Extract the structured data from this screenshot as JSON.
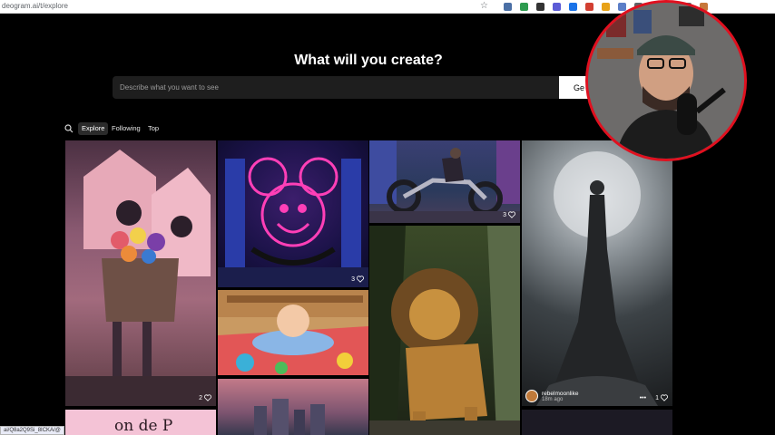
{
  "browser": {
    "url": "deogram.ai/t/explore",
    "status_url": "ai/Q8a2Q9Si_8ICKA/@",
    "extension_icons": [
      "#4a6fa5",
      "#2d9b4f",
      "#333333",
      "#5b5bd6",
      "#1a73e8",
      "#d23f31",
      "#e8a217",
      "#5b7ec7",
      "#5f6368",
      "#333333",
      "#5f6368",
      "#5f6368",
      "#c7773a"
    ]
  },
  "heading": "What will you create?",
  "prompt": {
    "placeholder": "Describe what you want to see",
    "generate_label": "Ge"
  },
  "tabs": [
    {
      "label": "Explore",
      "active": true
    },
    {
      "label": "Following",
      "active": false
    },
    {
      "label": "Top",
      "active": false
    }
  ],
  "tiles": [
    {
      "subject": "pink-storybook-house-with-cat",
      "likes": "2"
    },
    {
      "subject": "neon-mouse-castle",
      "likes": "3"
    },
    {
      "subject": "baby-on-play-mat",
      "likes": ""
    },
    {
      "subject": "pink-city-skyline",
      "likes": ""
    },
    {
      "subject": "motorcycle-rider",
      "likes": "3"
    },
    {
      "subject": "lion",
      "likes": ""
    },
    {
      "subject": "woman-in-gown-under-moon",
      "likes": "1",
      "author": "rebelmoonlike",
      "time": "18m ago"
    },
    {
      "subject": "pink-text-card",
      "likes": "",
      "text": "on de P"
    }
  ],
  "colors": {
    "background": "#000000",
    "prompt_bg": "#1e1e1e",
    "active_tab_bg": "#2b2b2b",
    "cam_border": "#e0101f"
  }
}
